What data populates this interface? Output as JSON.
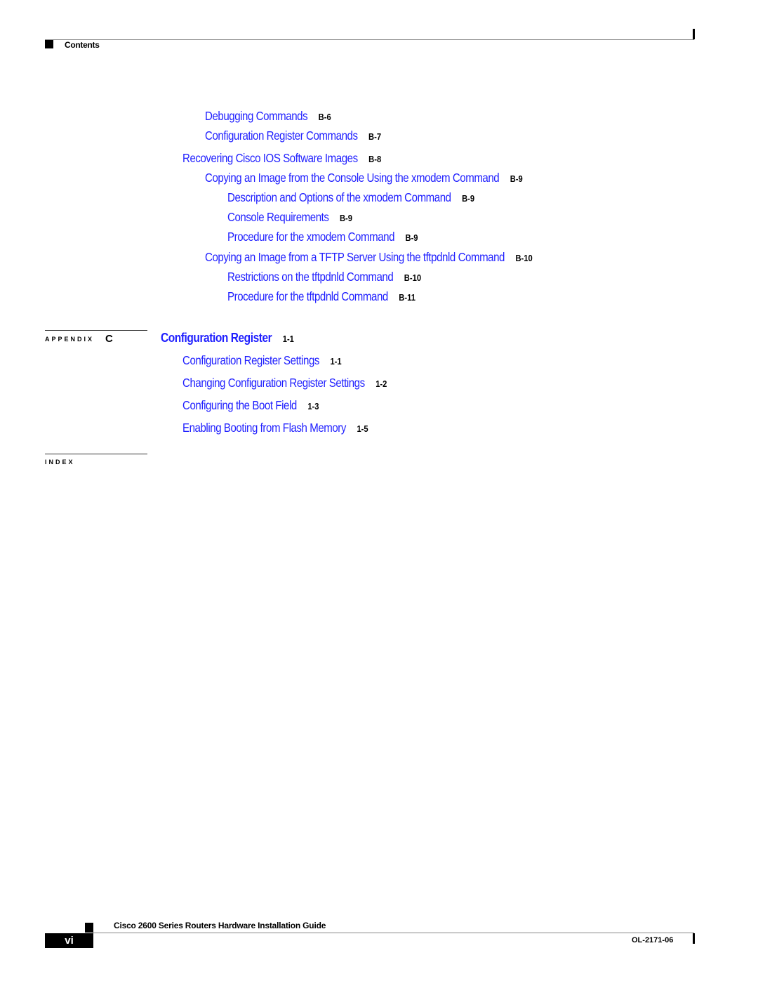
{
  "header": {
    "section_label": "Contents"
  },
  "toc_entries_top": [
    {
      "title": "Debugging Commands",
      "page": "B-6"
    },
    {
      "title": "Configuration Register Commands",
      "page": "B-7"
    },
    {
      "title": "Recovering Cisco IOS Software Images",
      "page": "B-8"
    },
    {
      "title": "Copying an Image from the Console Using the xmodem Command",
      "page": "B-9"
    },
    {
      "title": "Description and Options of the xmodem Command",
      "page": "B-9"
    },
    {
      "title": "Console Requirements",
      "page": "B-9"
    },
    {
      "title": "Procedure for the xmodem Command",
      "page": "B-9"
    },
    {
      "title": "Copying an Image from a TFTP Server Using the tftpdnld Command",
      "page": "B-10"
    },
    {
      "title": "Restrictions on the tftpdnld Command",
      "page": "B-10"
    },
    {
      "title": "Procedure for the tftpdnld Command",
      "page": "B-11"
    }
  ],
  "appendix_c": {
    "label": "APPENDIX",
    "letter": "C",
    "title": "Configuration Register",
    "page": "1-1",
    "entries": [
      {
        "title": "Configuration Register Settings",
        "page": "1-1"
      },
      {
        "title": "Changing Configuration Register Settings",
        "page": "1-2"
      },
      {
        "title": "Configuring the Boot Field",
        "page": "1-3"
      },
      {
        "title": "Enabling Booting from Flash Memory",
        "page": "1-5"
      }
    ]
  },
  "index": {
    "label": "INDEX"
  },
  "footer": {
    "book_title": "Cisco 2600 Series Routers Hardware Installation Guide",
    "page_number": "vi",
    "doc_number": "OL-2171-06"
  }
}
